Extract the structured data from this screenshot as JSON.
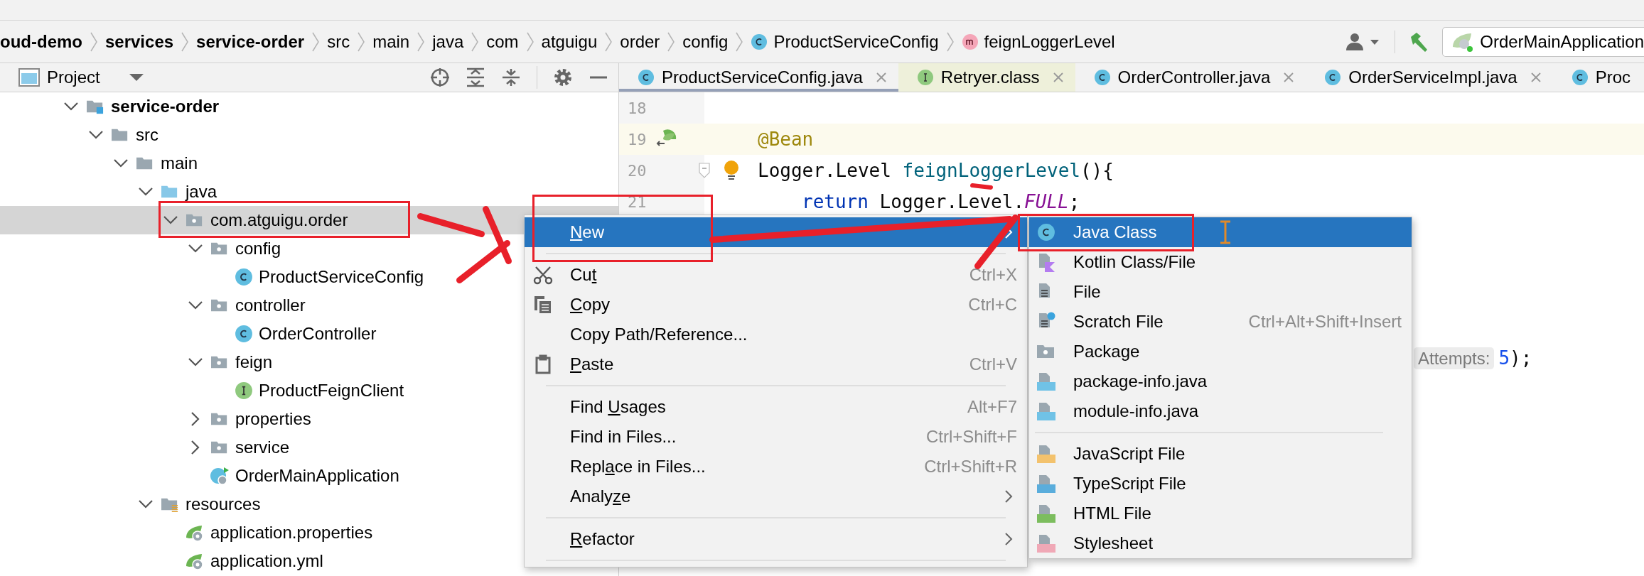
{
  "navigation_bar": {
    "crumbs": [
      {
        "label": "oud-demo",
        "kind": "module"
      },
      {
        "label": "services",
        "kind": "module"
      },
      {
        "label": "service-order",
        "kind": "module"
      },
      {
        "label": "src",
        "kind": "directory"
      },
      {
        "label": "main",
        "kind": "directory"
      },
      {
        "label": "java",
        "kind": "directory"
      },
      {
        "label": "com",
        "kind": "directory"
      },
      {
        "label": "atguigu",
        "kind": "directory"
      },
      {
        "label": "order",
        "kind": "directory"
      },
      {
        "label": "config",
        "kind": "directory"
      },
      {
        "label": "ProductServiceConfig",
        "kind": "class"
      },
      {
        "label": "feignLoggerLevel",
        "kind": "method"
      }
    ],
    "run_configuration": "OrderMainApplication"
  },
  "project_panel": {
    "title": "Project",
    "tree": [
      {
        "label": "service-order",
        "kind": "module",
        "expanded": true,
        "selected": false,
        "children": [
          {
            "label": "src",
            "kind": "folder",
            "expanded": true,
            "selected": false,
            "children": [
              {
                "label": "main",
                "kind": "folder",
                "expanded": true,
                "selected": false,
                "children": [
                  {
                    "label": "java",
                    "kind": "source-folder",
                    "expanded": true,
                    "selected": false,
                    "children": [
                      {
                        "label": "com.atguigu.order",
                        "kind": "package",
                        "expanded": true,
                        "selected": true,
                        "children": [
                          {
                            "label": "config",
                            "kind": "package",
                            "expanded": true,
                            "selected": false,
                            "children": [
                              {
                                "label": "ProductServiceConfig",
                                "kind": "class",
                                "selected": false
                              }
                            ]
                          },
                          {
                            "label": "controller",
                            "kind": "package",
                            "expanded": true,
                            "selected": false,
                            "children": [
                              {
                                "label": "OrderController",
                                "kind": "class",
                                "selected": false
                              }
                            ]
                          },
                          {
                            "label": "feign",
                            "kind": "package",
                            "expanded": true,
                            "selected": false,
                            "children": [
                              {
                                "label": "ProductFeignClient",
                                "kind": "interface",
                                "selected": false
                              }
                            ]
                          },
                          {
                            "label": "properties",
                            "kind": "package",
                            "expanded": false,
                            "selected": false
                          },
                          {
                            "label": "service",
                            "kind": "package",
                            "expanded": false,
                            "selected": false
                          },
                          {
                            "label": "OrderMainApplication",
                            "kind": "spring-class",
                            "selected": false
                          }
                        ]
                      }
                    ]
                  },
                  {
                    "label": "resources",
                    "kind": "resources",
                    "expanded": true,
                    "selected": false,
                    "children": [
                      {
                        "label": "application.properties",
                        "kind": "spring-config",
                        "selected": false
                      },
                      {
                        "label": "application.yml",
                        "kind": "spring-config",
                        "selected": false
                      }
                    ]
                  }
                ]
              }
            ]
          }
        ]
      }
    ]
  },
  "editor": {
    "tabs": [
      {
        "label": "ProductServiceConfig.java",
        "kind": "class",
        "selected": true
      },
      {
        "label": "Retryer.class",
        "kind": "library-interface",
        "selected": false
      },
      {
        "label": "OrderController.java",
        "kind": "class",
        "selected": false
      },
      {
        "label": "OrderServiceImpl.java",
        "kind": "class",
        "selected": false
      },
      {
        "label": "Proc",
        "kind": "cut-class",
        "selected": false
      }
    ],
    "lines": [
      {
        "number": "18",
        "kind": "blank",
        "current": false
      },
      {
        "number": "19",
        "kind": "bean-member",
        "current": true,
        "segments": [
          {
            "kind": "annotation",
            "text": "@Bean"
          }
        ]
      },
      {
        "number": "20",
        "kind": "method-header",
        "current": false,
        "segments": [
          {
            "kind": "plain",
            "text": "Logger.Level "
          },
          {
            "kind": "method",
            "text": "feignLoggerLevel"
          },
          {
            "kind": "plain",
            "text": "(){"
          }
        ]
      },
      {
        "number": "21",
        "kind": "statement",
        "current": false,
        "segments": [
          {
            "kind": "keyword",
            "text": "return"
          },
          {
            "kind": "plain",
            "text": " Logger.Level."
          },
          {
            "kind": "constant",
            "text": "FULL"
          },
          {
            "kind": "plain",
            "text": ";"
          }
        ]
      }
    ],
    "hint_line": {
      "segments": [
        {
          "kind": "hint",
          "text": "Attempts:"
        },
        {
          "kind": "number",
          "text": "5"
        },
        {
          "kind": "plain",
          "text": ");"
        }
      ]
    }
  },
  "context_menu": {
    "items": [
      {
        "kind": "submenu",
        "label": {
          "key": "N",
          "after": "ew"
        },
        "selected": true
      },
      {
        "kind": "separator"
      },
      {
        "kind": "cut",
        "label": {
          "before": "Cu",
          "key": "t"
        },
        "shortcut": "Ctrl+X",
        "selected": false
      },
      {
        "kind": "copy",
        "label": {
          "key": "C",
          "after": "opy"
        },
        "shortcut": "Ctrl+C",
        "selected": false
      },
      {
        "kind": "item",
        "label": "Copy Path/Reference...",
        "selected": false
      },
      {
        "kind": "paste",
        "label": {
          "key": "P",
          "after": "aste"
        },
        "shortcut": "Ctrl+V",
        "selected": false
      },
      {
        "kind": "separator"
      },
      {
        "kind": "item",
        "label": {
          "before": "Find ",
          "key": "U",
          "after": "sages"
        },
        "shortcut": "Alt+F7",
        "selected": false
      },
      {
        "kind": "item",
        "label": "Find in Files...",
        "shortcut": "Ctrl+Shift+F",
        "selected": false
      },
      {
        "kind": "item",
        "label": {
          "before": "Repl",
          "key": "a",
          "after": "ce in Files..."
        },
        "shortcut": "Ctrl+Shift+R",
        "selected": false
      },
      {
        "kind": "submenu",
        "label": {
          "before": "Analy",
          "key": "z",
          "after": "e"
        },
        "selected": false
      },
      {
        "kind": "separator"
      },
      {
        "kind": "submenu",
        "label": {
          "key": "R",
          "after": "efactor"
        },
        "selected": false
      },
      {
        "kind": "separator"
      }
    ]
  },
  "new_submenu": {
    "items": [
      {
        "kind": "java-class",
        "label": "Java Class",
        "selected": true
      },
      {
        "kind": "kotlin",
        "label": "Kotlin Class/File",
        "selected": false
      },
      {
        "kind": "file",
        "label": "File",
        "selected": false
      },
      {
        "kind": "scratch",
        "label": "Scratch File",
        "shortcut": "Ctrl+Alt+Shift+Insert",
        "selected": false
      },
      {
        "kind": "package",
        "label": "Package",
        "selected": false
      },
      {
        "kind": "java-file",
        "label": "package-info.java",
        "selected": false
      },
      {
        "kind": "java-file",
        "label": "module-info.java",
        "selected": false
      },
      {
        "kind": "separator"
      },
      {
        "kind": "javascript",
        "label": "JavaScript File",
        "selected": false
      },
      {
        "kind": "typescript",
        "label": "TypeScript File",
        "selected": false
      },
      {
        "kind": "html",
        "label": "HTML File",
        "selected": false
      },
      {
        "kind": "stylesheet",
        "label": "Stylesheet",
        "selected": false
      }
    ]
  }
}
